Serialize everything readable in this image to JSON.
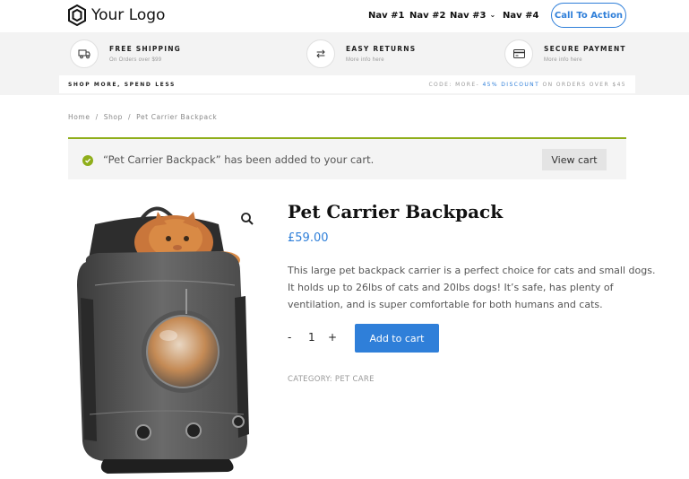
{
  "header": {
    "logo_text": "Your Logo",
    "nav": [
      "Nav #1",
      "Nav #2",
      "Nav #3",
      "Nav #4"
    ],
    "cta_label": "Call To Action"
  },
  "features": [
    {
      "title": "FREE SHIPPING",
      "sub": "On Orders over $99",
      "icon": "truck-icon"
    },
    {
      "title": "EASY RETURNS",
      "sub": "More info here",
      "icon": "exchange-icon"
    },
    {
      "title": "SECURE PAYMENT",
      "sub": "More info here",
      "icon": "credit-card-icon"
    }
  ],
  "promo": {
    "left": "SHOP MORE, SPEND LESS",
    "right_prefix": "CODE: MORE-",
    "right_highlight": "45% DISCOUNT",
    "right_suffix": "ON ORDERS OVER $45"
  },
  "breadcrumb": [
    "Home",
    "Shop",
    "Pet Carrier Backpack"
  ],
  "notice": {
    "text": "“Pet Carrier Backpack” has been added to your cart.",
    "button": "View cart"
  },
  "product": {
    "title": "Pet Carrier Backpack",
    "price": "£59.00",
    "description_lines": [
      "This large pet backpack carrier is a perfect choice for cats and small dogs.",
      "It holds up to 26lbs of cats and 20lbs dogs! It’s safe, has plenty of",
      "ventilation, and is super comfortable for both humans and cats."
    ],
    "quantity": "1",
    "minus": "-",
    "plus": "+",
    "add_to_cart": "Add to cart",
    "category": "CATEGORY: PET CARE"
  },
  "colors": {
    "accent": "#2f7fd9",
    "success": "#8fae1b"
  }
}
